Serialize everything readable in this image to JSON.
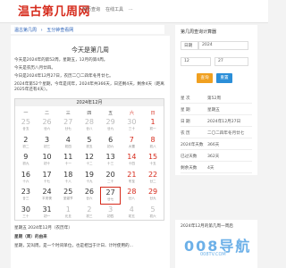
{
  "header": {
    "logo": "温古第几周网",
    "nav": [
      "日历查询",
      "在线工具",
      "..."
    ]
  },
  "breadcrumb": [
    "温古第几周",
    "五分钟查看网"
  ],
  "main": {
    "title": "今天是第几周",
    "lines": [
      "今天是2024年的第52周，星期五，12月的第4周。",
      "今天是农历八月廿四。",
      "今日是2024年12月27日，农历二〇二四年冬月廿七。",
      "2024年第52个星期，今年是闰年，2024年共366天，日还剩4天，剩余4天（距离2025年还有4天）。"
    ],
    "calendar": {
      "header": "2024年12月",
      "weekdays": [
        "一",
        "二",
        "三",
        "四",
        "五",
        "六",
        "日"
      ],
      "weeks": [
        [
          "25",
          "26",
          "27",
          "28",
          "29",
          "30",
          "1"
        ],
        [
          "2",
          "3",
          "4",
          "5",
          "6",
          "7",
          "8"
        ],
        [
          "9",
          "10",
          "11",
          "12",
          "13",
          "14",
          "15"
        ],
        [
          "16",
          "17",
          "18",
          "19",
          "20",
          "21",
          "22"
        ],
        [
          "23",
          "24",
          "25",
          "26",
          "27",
          "28",
          "29"
        ],
        [
          "30",
          "31",
          "1",
          "2",
          "3",
          "4",
          "5"
        ]
      ],
      "lunar": [
        [
          "廿五",
          "廿六",
          "廿七",
          "廿八",
          "廿九",
          "三十",
          "初一"
        ],
        [
          "初二",
          "初三",
          "初四",
          "初五",
          "初六",
          "大雪",
          "初八"
        ],
        [
          "初九",
          "初十",
          "十一",
          "十二",
          "十三",
          "十四",
          "十五"
        ],
        [
          "十六",
          "十七",
          "十八",
          "十九",
          "二十",
          "冬至",
          "廿二"
        ],
        [
          "廿三",
          "平安夜",
          "圣诞节",
          "廿六",
          "廿七",
          "廿八",
          "廿九"
        ],
        [
          "三十",
          "初一",
          "元旦",
          "初三",
          "初四",
          "初五",
          "初六"
        ]
      ]
    },
    "section1": "星期五 2024年12月（农历年）",
    "section2": "星期（周）的由来",
    "section3": "星期，又叫周，是一个时间单位，也是相当于计日、计时使用的..."
  },
  "sidebar": {
    "title": "第几周查询计算器",
    "date_label": "日期",
    "year": "2024",
    "month": "12",
    "day": "27",
    "query_btn": "查询",
    "reset_btn": "重置",
    "rows": [
      {
        "k": "星 次",
        "v": "第52周"
      },
      {
        "k": "星 期",
        "v": "星期五"
      },
      {
        "k": "日 期",
        "v": "2024年12月27日"
      },
      {
        "k": "农 历",
        "v": "二〇二四年冬月廿七"
      },
      {
        "k": "2024年天数",
        "v": "366天"
      },
      {
        "k": "已过天数",
        "v": "362天"
      },
      {
        "k": "剩余天数",
        "v": "4天"
      }
    ],
    "note": "2024年12月的第几周一周后"
  },
  "watermark": "008导航",
  "watermark_sub": "008TV.COM",
  "colors": {
    "accent": "#d62a1b",
    "link": "#2b62b8",
    "btn_orange": "#f0a020",
    "btn_blue": "#2b8ed8"
  }
}
